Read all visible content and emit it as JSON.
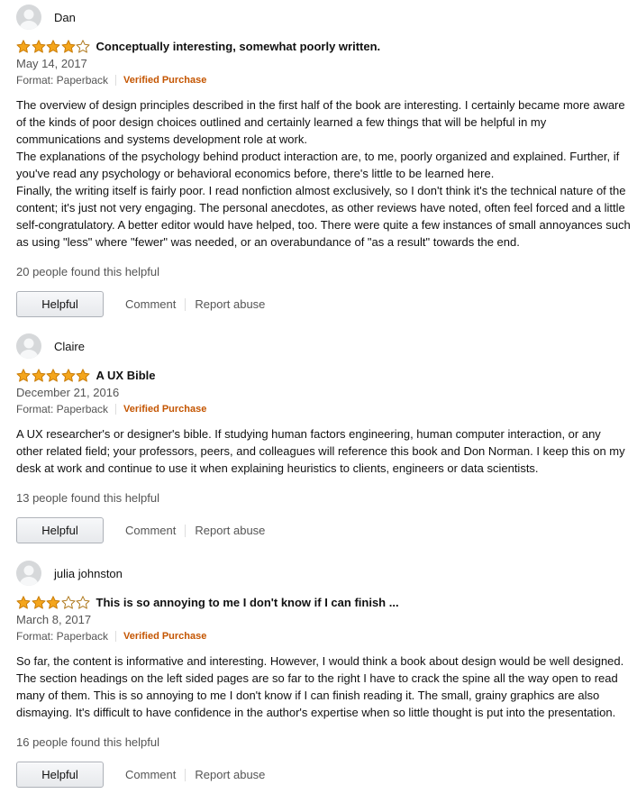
{
  "colors": {
    "star_fill": "#f4a51c",
    "star_stroke": "#c97d09",
    "verified": "#c45500",
    "avatar_bg": "#d6d8da"
  },
  "reviews": [
    {
      "reviewer": "Dan",
      "stars": 4,
      "title": "Conceptually interesting, somewhat poorly written.",
      "date": "May 14, 2017",
      "format": "Format: Paperback",
      "verified": "Verified Purchase",
      "body": "The overview of design principles described in the first half of the book are interesting. I certainly became more aware of the kinds of poor design choices outlined and certainly learned a few things that will be helpful in my communications and systems development role at work.\nThe explanations of the psychology behind product interaction are, to me, poorly organized and explained. Further, if you've read any psychology or behavioral economics before, there's little to be learned here.\nFinally, the writing itself is fairly poor. I read nonfiction almost exclusively, so I don't think it's the technical nature of the content; it's just not very engaging. The personal anecdotes, as other reviews have noted, often feel forced and a little self-congratulatory. A better editor would have helped, too. There were quite a few instances of small annoyances such as using \"less\" where \"fewer\" was needed, or an overabundance of \"as a result\" towards the end.",
      "helpful_count": "20 people found this helpful",
      "helpful_label": "Helpful",
      "comment_label": "Comment",
      "report_label": "Report abuse"
    },
    {
      "reviewer": "Claire",
      "stars": 5,
      "title": "A UX Bible",
      "date": "December 21, 2016",
      "format": "Format: Paperback",
      "verified": "Verified Purchase",
      "body": "A UX researcher's or designer's bible. If studying human factors engineering, human computer interaction, or any other related field; your professors, peers, and colleagues will reference this book and Don Norman. I keep this on my desk at work and continue to use it when explaining heuristics to clients, engineers or data scientists.",
      "helpful_count": "13 people found this helpful",
      "helpful_label": "Helpful",
      "comment_label": "Comment",
      "report_label": "Report abuse"
    },
    {
      "reviewer": "julia johnston",
      "stars": 3,
      "title": "This is so annoying to me I don't know if I can finish ...",
      "date": "March 8, 2017",
      "format": "Format: Paperback",
      "verified": "Verified Purchase",
      "body": "So far, the content is informative and interesting. However, I would think a book about design would be well designed. The section headings on the left sided pages are so far to the right I have to crack the spine all the way open to read many of them. This is so annoying to me I don't know if I can finish reading it. The small, grainy graphics are also dismaying. It's difficult to have confidence in the author's expertise when so little thought is put into the presentation.",
      "helpful_count": "16 people found this helpful",
      "helpful_label": "Helpful",
      "comment_label": "Comment",
      "report_label": "Report abuse"
    }
  ]
}
